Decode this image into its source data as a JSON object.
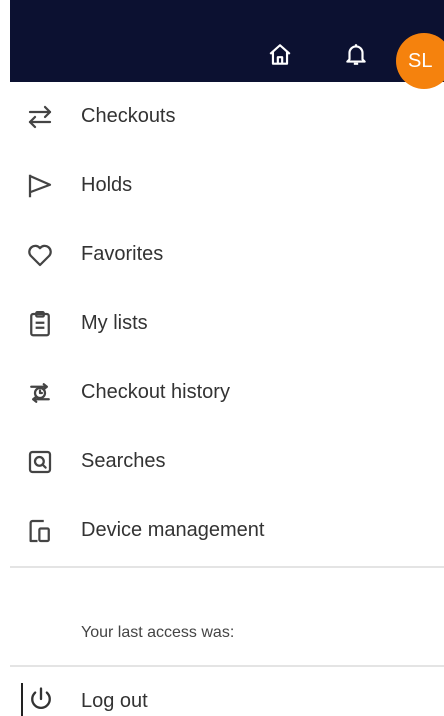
{
  "header": {
    "home_icon": "home-icon",
    "bell_icon": "bell-icon",
    "avatar_initials": "SL",
    "colors": {
      "bar": "#0c1131",
      "avatar": "#f5820d"
    }
  },
  "menu": {
    "items": [
      {
        "label": "Checkouts",
        "icon": "swap-arrows-icon"
      },
      {
        "label": "Holds",
        "icon": "flag-icon"
      },
      {
        "label": "Favorites",
        "icon": "heart-icon"
      },
      {
        "label": "My lists",
        "icon": "clipboard-icon"
      },
      {
        "label": "Checkout history",
        "icon": "history-icon"
      },
      {
        "label": "Searches",
        "icon": "search-box-icon"
      },
      {
        "label": "Device management",
        "icon": "devices-icon"
      }
    ]
  },
  "last_access_label": "Your last access was:",
  "logout": {
    "label": "Log out",
    "icon": "power-icon"
  }
}
